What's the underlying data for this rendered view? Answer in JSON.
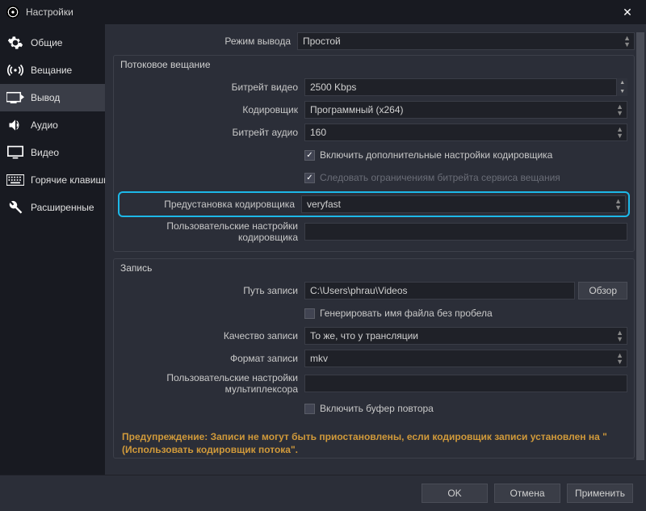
{
  "window": {
    "title": "Настройки"
  },
  "sidebar": {
    "items": [
      {
        "label": "Общие"
      },
      {
        "label": "Вещание"
      },
      {
        "label": "Вывод"
      },
      {
        "label": "Аудио"
      },
      {
        "label": "Видео"
      },
      {
        "label": "Горячие клавиши"
      },
      {
        "label": "Расширенные"
      }
    ]
  },
  "output_mode": {
    "label": "Режим вывода",
    "value": "Простой"
  },
  "streaming": {
    "title": "Потоковое вещание",
    "video_bitrate_label": "Битрейт видео",
    "video_bitrate_value": "2500 Kbps",
    "encoder_label": "Кодировщик",
    "encoder_value": "Программный (x264)",
    "audio_bitrate_label": "Битрейт аудио",
    "audio_bitrate_value": "160",
    "enable_advanced": "Включить дополнительные настройки кодировщика",
    "follow_limits": "Следовать ограничениям битрейта сервиса вещания",
    "encoder_preset_label": "Предустановка кодировщика",
    "encoder_preset_value": "veryfast",
    "custom_encoder_label": "Пользовательские настройки кодировщика"
  },
  "recording": {
    "title": "Запись",
    "path_label": "Путь записи",
    "path_value": "C:\\Users\\phrau\\Videos",
    "browse": "Обзор",
    "no_space_filename": "Генерировать имя файла без пробела",
    "quality_label": "Качество записи",
    "quality_value": "То же, что у трансляции",
    "format_label": "Формат записи",
    "format_value": "mkv",
    "mux_label": "Пользовательские настройки мультиплексора",
    "replay_buffer": "Включить буфер повтора"
  },
  "warning": "Предупреждение: Записи не могут быть приостановлены, если кодировщик записи установлен на \"(Использовать кодировщик потока\".",
  "footer": {
    "ok": "OK",
    "cancel": "Отмена",
    "apply": "Применить"
  }
}
